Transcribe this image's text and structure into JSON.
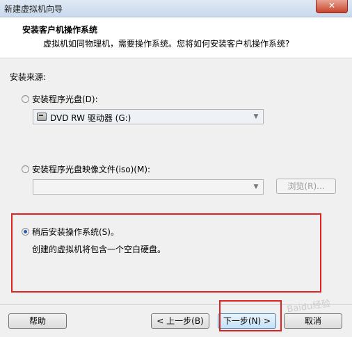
{
  "window": {
    "title": "新建虚拟机向导",
    "close_label": "✕"
  },
  "header": {
    "title": "安装客户机操作系统",
    "subtitle": "虚拟机如同物理机，需要操作系统。您将如何安装客户机操作系统?"
  },
  "install_source": {
    "label": "安装来源:",
    "options": {
      "disc": {
        "label": "安装程序光盘(D):",
        "selected": false,
        "drive_value": "DVD RW 驱动器 (G:)"
      },
      "iso": {
        "label": "安装程序光盘映像文件(iso)(M):",
        "selected": false,
        "path_value": "",
        "browse_label": "浏览(R)..."
      },
      "later": {
        "label": "稍后安装操作系统(S)。",
        "selected": true,
        "description": "创建的虚拟机将包含一个空白硬盘。"
      }
    }
  },
  "footer": {
    "help_label": "帮助",
    "back_label": "< 上一步(B)",
    "next_label": "下一步(N) >",
    "cancel_label": "取消"
  },
  "watermark": "Baidu经验"
}
